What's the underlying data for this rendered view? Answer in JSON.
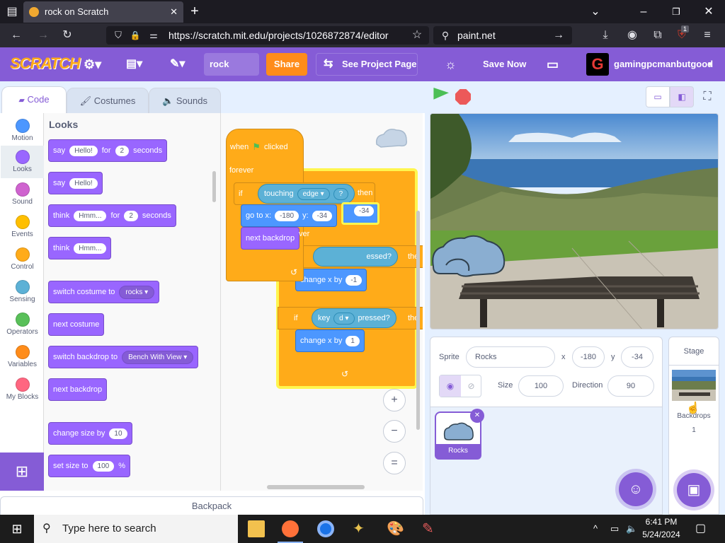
{
  "browser": {
    "tab_title": "rock on Scratch",
    "tab_close": "✕",
    "new_tab": "+",
    "url": "https://scratch.mit.edu/projects/1026872874/editor",
    "search_text": "paint.net",
    "extension_badge": "1"
  },
  "menubar": {
    "logo": "SCRATCH",
    "project_title": "rock",
    "share": "Share",
    "see_project_page": "See Project Page",
    "save_now": "Save Now",
    "username": "gamingpcmanbutgood",
    "colors": {
      "bar": "#855cd6",
      "share": "#ff8c1a"
    }
  },
  "editor_tabs": [
    "Code",
    "Costumes",
    "Sounds"
  ],
  "categories": [
    {
      "label": "Motion",
      "color": "#4c97ff"
    },
    {
      "label": "Looks",
      "color": "#9966ff"
    },
    {
      "label": "Sound",
      "color": "#cf63cf"
    },
    {
      "label": "Events",
      "color": "#ffbf00"
    },
    {
      "label": "Control",
      "color": "#ffab19"
    },
    {
      "label": "Sensing",
      "color": "#5cb1d6"
    },
    {
      "label": "Operators",
      "color": "#59c059"
    },
    {
      "label": "Variables",
      "color": "#ff8c1a"
    },
    {
      "label": "My Blocks",
      "color": "#ff6680"
    }
  ],
  "palette": {
    "heading": "Looks",
    "say_for": {
      "say": "say",
      "msg": "Hello!",
      "for": "for",
      "secs": "2",
      "seconds": "seconds"
    },
    "say": {
      "say": "say",
      "msg": "Hello!"
    },
    "think_for": {
      "think": "think",
      "msg": "Hmm...",
      "for": "for",
      "secs": "2",
      "seconds": "seconds"
    },
    "think": {
      "think": "think",
      "msg": "Hmm..."
    },
    "switch_costume": {
      "label": "switch costume to",
      "value": "rocks"
    },
    "next_costume": "next costume",
    "switch_backdrop": {
      "label": "switch backdrop to",
      "value": "Bench With View"
    },
    "next_backdrop": "next backdrop",
    "change_size": {
      "label": "change size by",
      "value": "10"
    },
    "set_size": {
      "label": "set size to",
      "value": "100",
      "unit": "%"
    }
  },
  "script": {
    "when": "when",
    "clicked": "clicked",
    "forever": "forever",
    "if": "if",
    "touching": "touching",
    "edge": "edge",
    "q": "?",
    "then": "then",
    "goto": "go to x:",
    "gx": "-180",
    "y": "y:",
    "gy": "-34",
    "gy2": "-34",
    "next_backdrop": "next backdrop",
    "ver": "ver",
    "pressed1": "essed?",
    "the1": "the",
    "change_x": "change x by",
    "cx1": "-1",
    "if2": "if",
    "key": "key",
    "keyval": "d",
    "pressed2": "pressed?",
    "the2": "the",
    "cx2": "1"
  },
  "zoom": {
    "in": "+",
    "out": "−",
    "reset": "="
  },
  "backpack": "Backpack",
  "sprite_info": {
    "sprite_label": "Sprite",
    "sprite_name": "Rocks",
    "x_label": "x",
    "x": "-180",
    "y_label": "y",
    "y": "-34",
    "size_label": "Size",
    "size": "100",
    "direction_label": "Direction",
    "direction": "90"
  },
  "sprites": [
    {
      "name": "Rocks"
    }
  ],
  "stage_pane": {
    "title": "Stage",
    "backdrops_label": "Backdrops",
    "backdrops_count": "1"
  },
  "taskbar": {
    "search_placeholder": "Type here to search",
    "time": "6:41 PM",
    "date": "5/24/2024"
  }
}
